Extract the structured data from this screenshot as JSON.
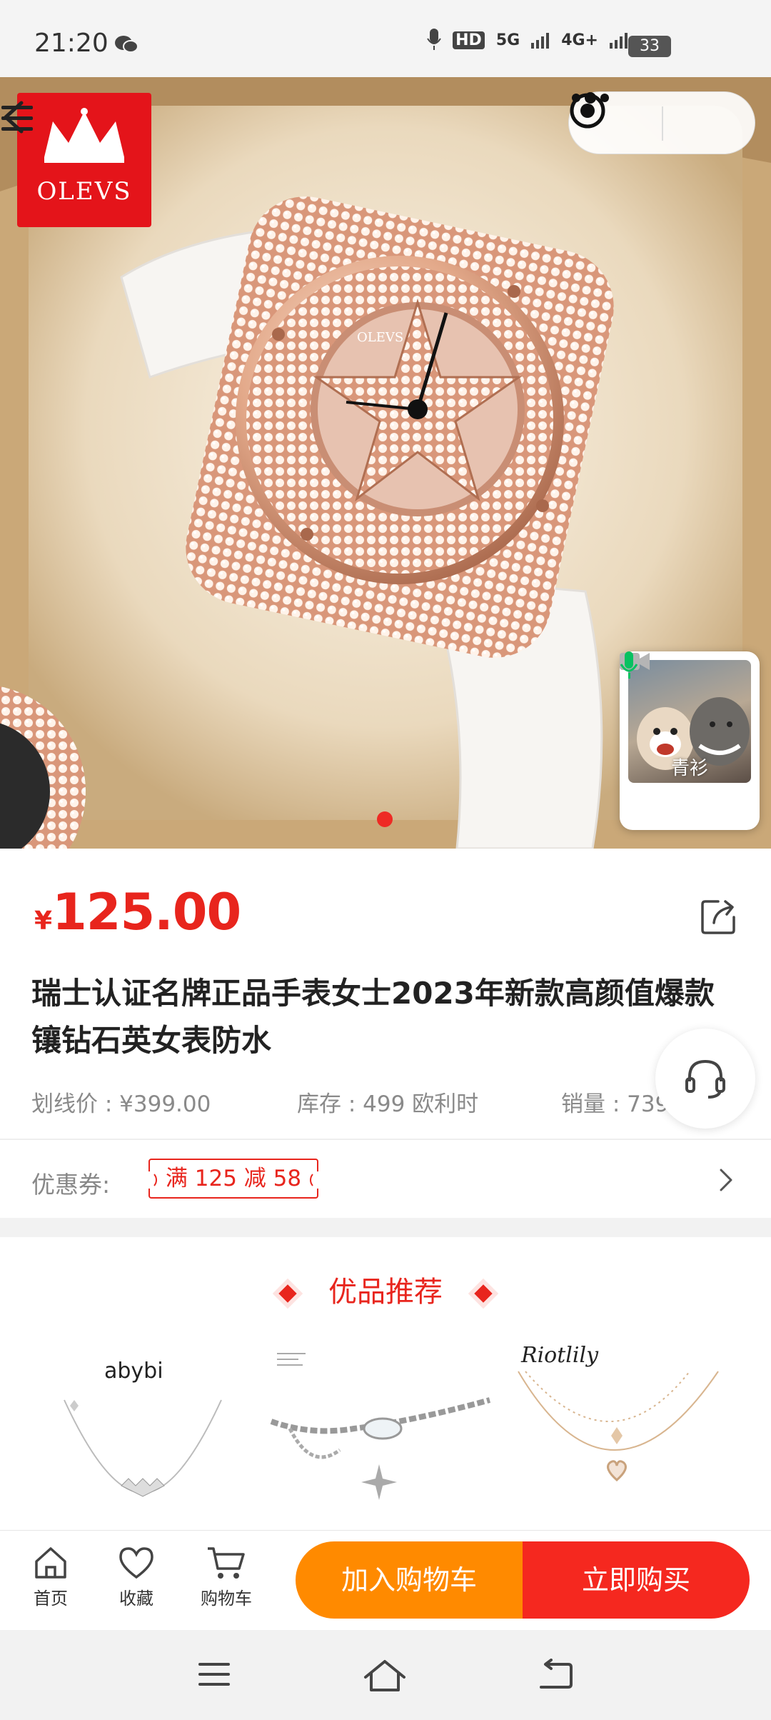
{
  "status_bar": {
    "time": "21:20",
    "network_1": "HD",
    "network_2": "5G",
    "network_3": "4G+",
    "battery": "33"
  },
  "header": {
    "brand_logo_text": "OLEVS"
  },
  "video_call": {
    "name": "青衫"
  },
  "product": {
    "price_symbol": "¥",
    "price": "125.00",
    "title": "瑞士认证名牌正品手表女士2023年新款高颜值爆款镶钻石英女表防水",
    "original_price": "划线价 : ¥399.00",
    "stock": "库存 : 499 欧利时",
    "sales": "销量 : 739"
  },
  "coupon": {
    "label": "优惠券:",
    "tag": "满 125 减 58"
  },
  "recommend": {
    "title": "优品推荐",
    "items": [
      {
        "brand": "abybi"
      },
      {
        "brand": ""
      },
      {
        "brand": "Riotlily"
      }
    ]
  },
  "action_bar": {
    "home": "首页",
    "favorite": "收藏",
    "cart": "购物车",
    "add_to_cart": "加入购物车",
    "buy_now": "立即购买"
  },
  "colors": {
    "accent_red": "#e8251d",
    "cart_orange": "#ff8a00",
    "buy_red": "#f5281f"
  }
}
